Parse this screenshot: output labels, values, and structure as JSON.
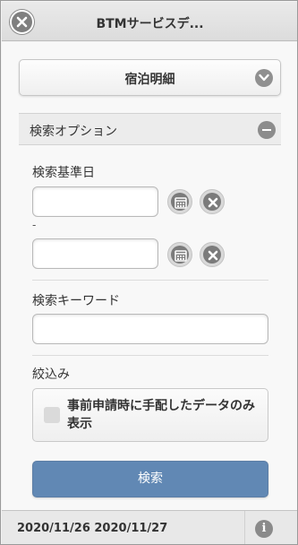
{
  "header": {
    "title": "BTMサービスデ...",
    "close_icon": "close-circle-icon"
  },
  "selector": {
    "label": "宿泊明細",
    "icon": "chevron-down-icon"
  },
  "search_options": {
    "title": "検索オプション",
    "icon": "minus-icon",
    "date_label": "検索基準日",
    "date_from": "",
    "date_separator": "-",
    "date_to": "",
    "calendar_icon": "calendar-icon",
    "clear_icon": "clear-icon",
    "keyword_label": "検索キーワード",
    "keyword_value": "",
    "filter_label": "絞込み",
    "filter_checkbox_label": "事前申請時に手配したデータのみ表示",
    "filter_checked": false,
    "search_button": "検索"
  },
  "footer": {
    "date_range": "2020/11/26 2020/11/27",
    "info_icon": "info-icon",
    "info_glyph": "i"
  },
  "colors": {
    "primary_button": "#6188b4",
    "icon_gray": "#7b7b7b"
  }
}
